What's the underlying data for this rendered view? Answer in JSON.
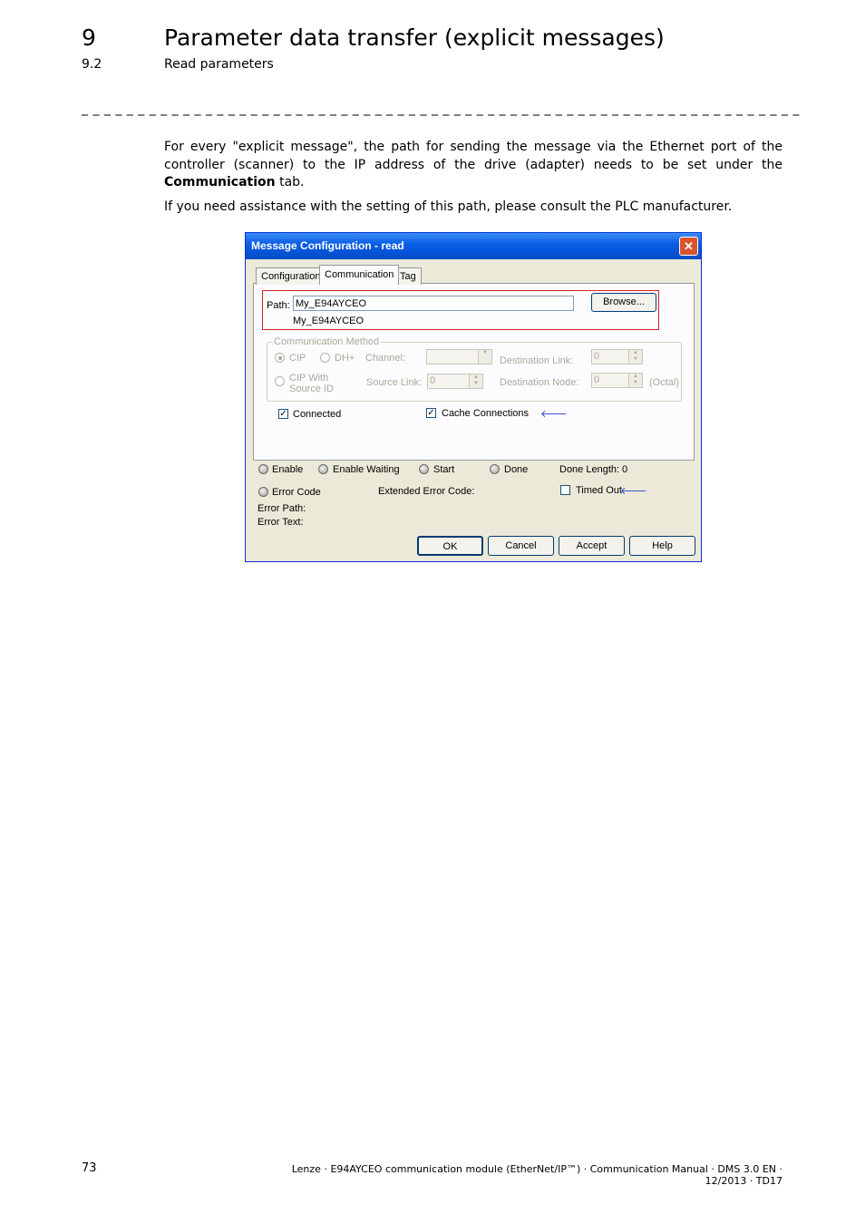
{
  "header": {
    "chapter_number": "9",
    "chapter_title": "Parameter data transfer (explicit messages)",
    "section_number": "9.2",
    "section_title": "Read parameters",
    "separator": "_ _ _ _ _ _ _ _ _ _ _ _ _ _ _ _ _ _ _ _ _ _ _ _ _ _ _ _ _ _ _ _ _ _ _ _ _ _ _ _ _ _ _ _ _ _ _ _ _ _ _ _ _ _ _ _ _ _ _ _ _ _ _ _"
  },
  "body": {
    "para1_before": "For every \"explicit message\", the path for sending the message via the Ethernet port of the controller (scanner) to the IP address of the drive (adapter) needs to be set under the ",
    "para1_bold": "Communication",
    "para1_after": " tab.",
    "para2": "If you need assistance with the setting of this path, please consult the PLC manufacturer."
  },
  "dialog": {
    "title": "Message Configuration - read",
    "close_glyph": "✕",
    "tabs": [
      "Configuration",
      "Communication",
      "Tag"
    ],
    "path_label": "Path:",
    "path_value": "My_E94AYCEO",
    "path_resolved": "My_E94AYCEO",
    "browse_label": "Browse...",
    "comm_method_label": "Communication Method",
    "radio_cip": "CIP",
    "radio_dh": "DH+",
    "channel_label": "Channel:",
    "dest_link_label": "Destination Link:",
    "dest_link_value": "0",
    "radio_cip_with": "CIP With",
    "radio_cip_with_2": "Source ID",
    "source_link_label": "Source Link:",
    "source_link_value": "0",
    "dest_node_label": "Destination Node:",
    "dest_node_value": "0",
    "octal_label": "(Octal)",
    "connected_label": "Connected",
    "cache_label": "Cache Connections",
    "arrow_glyph": "🡐",
    "enable_label": "Enable",
    "enable_waiting_label": "Enable Waiting",
    "start_label": "Start",
    "done_label": "Done",
    "done_length_label": "Done Length:",
    "done_length_value": "0",
    "error_code_label": "Error Code",
    "ext_error_label": "Extended Error Code:",
    "timed_out_label": "Timed Out",
    "error_path_label": "Error Path:",
    "error_text_label": "Error Text:",
    "ok_label": "OK",
    "cancel_label": "Cancel",
    "accept_label": "Accept",
    "help_label": "Help",
    "check_glyph": "✓"
  },
  "footer": {
    "page_number": "73",
    "text": "Lenze · E94AYCEO communication module (EtherNet/IP™) · Communication Manual · DMS 3.0 EN · 12/2013 · TD17"
  }
}
